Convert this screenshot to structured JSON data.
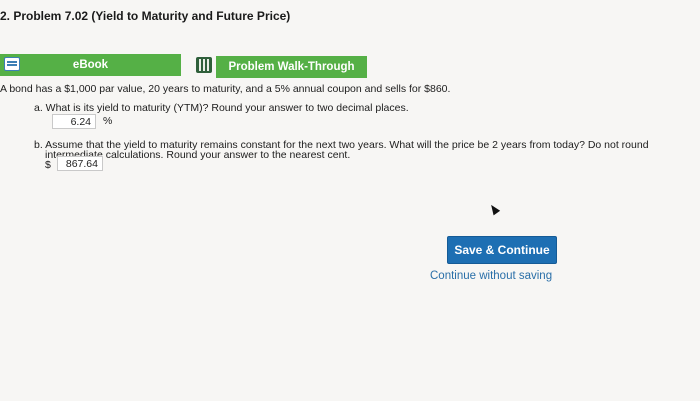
{
  "header": {
    "title": "2. Problem 7.02 (Yield to Maturity and Future Price)"
  },
  "resources": {
    "ebook_label": "eBook",
    "walkthrough_label": "Problem Walk-Through"
  },
  "problem": {
    "stem": "A bond has a $1,000 par value, 20 years to maturity, and a 5% annual coupon and sells for $860.",
    "part_a": {
      "question": "a. What is its yield to maturity (YTM)? Round your answer to two decimal places.",
      "answer": "6.24",
      "unit": "%"
    },
    "part_b": {
      "question_line1": "b. Assume that the yield to maturity remains constant for the next two years. What will the price be 2 years from today? Do not round",
      "question_line2": "intermediate calculations. Round your answer to the nearest cent.",
      "currency": "$",
      "answer": "867.64"
    }
  },
  "actions": {
    "save_label": "Save & Continue",
    "continue_label": "Continue without saving"
  },
  "colors": {
    "green": "#55b046",
    "blue_button": "#1d6fb3",
    "link": "#2a6fa8"
  }
}
